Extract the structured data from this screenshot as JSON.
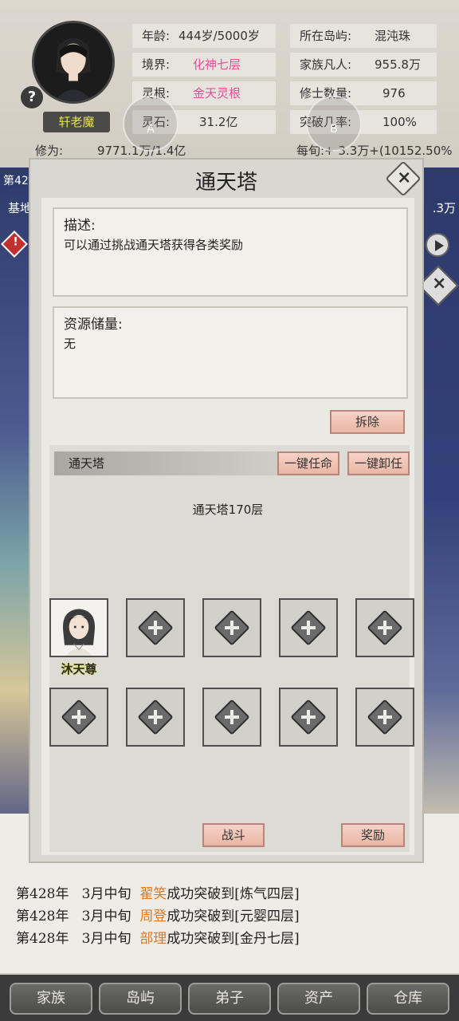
{
  "player": {
    "name": "轩老魔",
    "age_label": "年龄:",
    "age_value": "444岁/5000岁",
    "realm_label": "境界:",
    "realm_value": "化神七层",
    "root_label": "灵根:",
    "root_value": "金天灵根",
    "stone_label": "灵石:",
    "stone_value": "31.2亿",
    "cultivation_label": "修为:",
    "cultivation_value": "9771.1万/1.4亿",
    "per_period": "每旬:+ 3.3万+(10152.50%"
  },
  "island": {
    "island_label": "所在岛屿:",
    "island_value": "混沌珠",
    "mortals_label": "家族凡人:",
    "mortals_value": "955.8万",
    "cultivators_label": "修士数量:",
    "cultivators_value": "976",
    "breakthrough_label": "突破几率:",
    "breakthrough_value": "100%"
  },
  "overlay_buttons": {
    "a": "A",
    "b": "B"
  },
  "background": {
    "left_label": "第42",
    "left_label2": "基地",
    "right_label": ".3万"
  },
  "modal": {
    "title": "通天塔",
    "description_head": "描述:",
    "description_body": "可以通过挑战通天塔获得各类奖励",
    "resources_head": "资源储量:",
    "resources_body": "无",
    "demolish_label": "拆除",
    "section_title": "通天塔",
    "assign_all_label": "一键任命",
    "dismiss_all_label": "一键卸任",
    "floor_label": "通天塔170层",
    "member_name": "沐天尊",
    "battle_label": "战斗",
    "reward_label": "奖励"
  },
  "log": [
    {
      "prefix": "第428年",
      "time": "3月中旬",
      "name": "翟笑",
      "text": "成功突破到[炼气四层]"
    },
    {
      "prefix": "第428年",
      "time": "3月中旬",
      "name": "周登",
      "text": "成功突破到[元婴四层]"
    },
    {
      "prefix": "第428年",
      "time": "3月中旬",
      "name": "部理",
      "text": "成功突破到[金丹七层]"
    }
  ],
  "nav": [
    "家族",
    "岛屿",
    "弟子",
    "资产",
    "仓库"
  ],
  "colors": {
    "accent_pink": "#e2509a",
    "name_orange": "#d97a2a",
    "button_pink": "#eab6a6"
  }
}
